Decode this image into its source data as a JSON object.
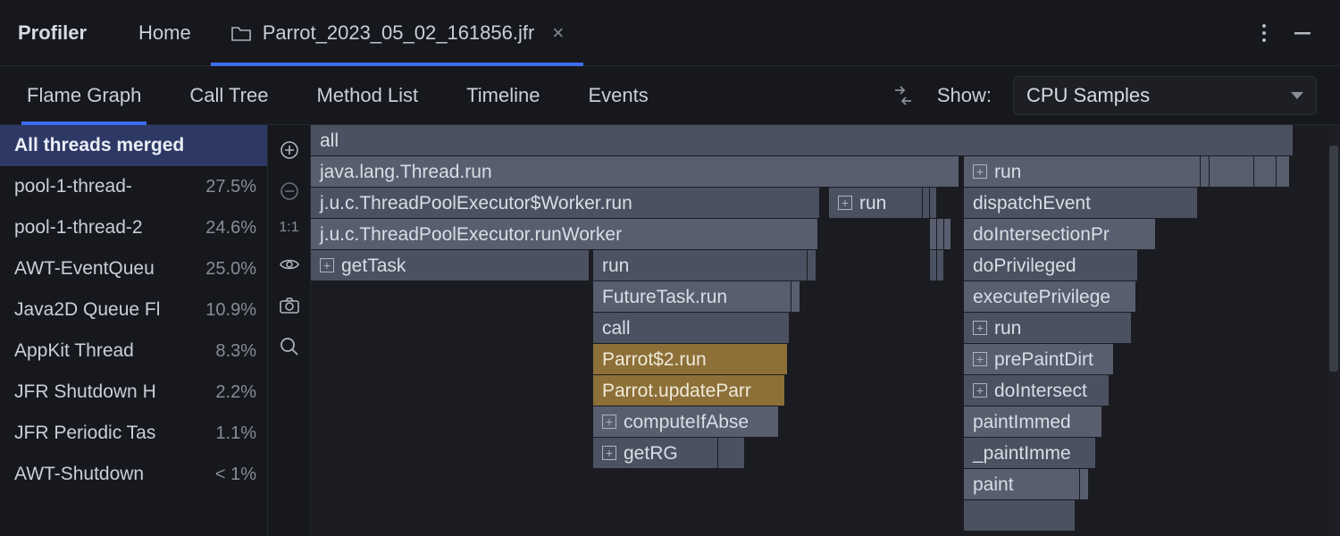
{
  "header": {
    "title": "Profiler",
    "tabs": [
      {
        "label": "Home"
      },
      {
        "label": "Parrot_2023_05_02_161856.jfr"
      }
    ]
  },
  "subtabs": [
    "Flame Graph",
    "Call Tree",
    "Method List",
    "Timeline",
    "Events"
  ],
  "show": {
    "label": "Show:",
    "selected": "CPU Samples"
  },
  "threads": [
    {
      "name": "All threads merged",
      "pct": ""
    },
    {
      "name": "pool-1-thread-",
      "pct": "27.5%"
    },
    {
      "name": "pool-1-thread-2",
      "pct": "24.6%"
    },
    {
      "name": "AWT-EventQueu",
      "pct": "25.0%"
    },
    {
      "name": "Java2D Queue Fl",
      "pct": "10.9%"
    },
    {
      "name": "AppKit Thread",
      "pct": "8.3%"
    },
    {
      "name": "JFR Shutdown H",
      "pct": "2.2%"
    },
    {
      "name": "JFR Periodic Tas",
      "pct": "1.1%"
    },
    {
      "name": "AWT-Shutdown",
      "pct": "< 1%"
    }
  ],
  "tool_ratio": "1:1",
  "flame": {
    "row0": {
      "all": "all"
    },
    "row1": {
      "a": "java.lang.Thread.run",
      "b": "run"
    },
    "row2": {
      "a": "j.u.c.ThreadPoolExecutor$Worker.run",
      "b": "run",
      "c": "dispatchEvent"
    },
    "row3": {
      "a": "j.u.c.ThreadPoolExecutor.runWorker",
      "b": "doIntersectionPr"
    },
    "row4": {
      "a": "getTask",
      "b": "run",
      "c": "doPrivileged"
    },
    "row5": {
      "a": "FutureTask.run",
      "b": "executePrivilege"
    },
    "row6": {
      "a": "call",
      "b": "run"
    },
    "row7": {
      "a": "Parrot$2.run",
      "b": "prePaintDirt"
    },
    "row8": {
      "a": "Parrot.updateParr",
      "b": "doIntersect"
    },
    "row9": {
      "a": "computeIfAbse",
      "b": "paintImmed"
    },
    "row10": {
      "a": "getRG",
      "b": "_paintImme"
    },
    "row11": {
      "a": "paint"
    }
  }
}
